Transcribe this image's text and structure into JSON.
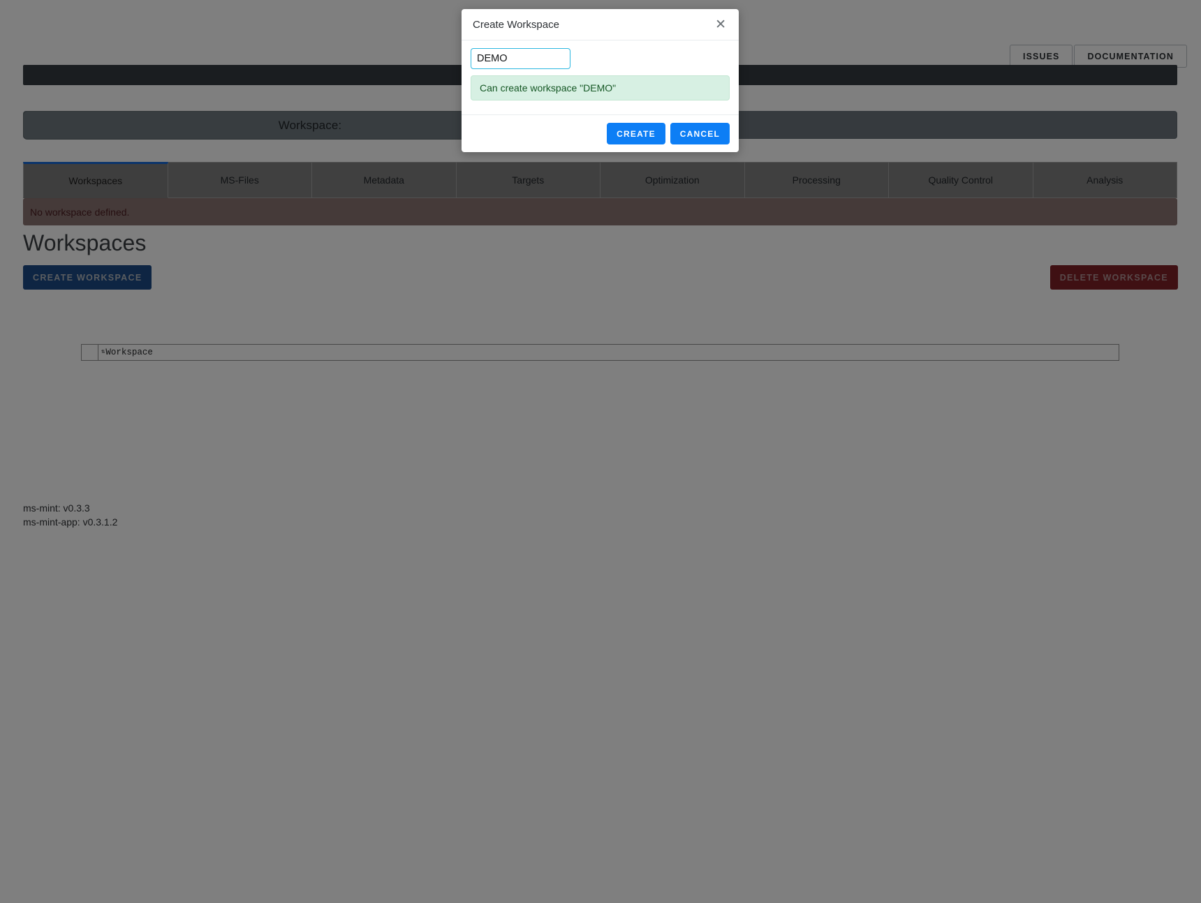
{
  "header": {
    "issues_label": "ISSUES",
    "documentation_label": "DOCUMENTATION"
  },
  "workspace_bar": {
    "label": "Workspace:"
  },
  "tabs": [
    {
      "label": "Workspaces",
      "active": true
    },
    {
      "label": "MS-Files",
      "active": false
    },
    {
      "label": "Metadata",
      "active": false
    },
    {
      "label": "Targets",
      "active": false
    },
    {
      "label": "Optimization",
      "active": false
    },
    {
      "label": "Processing",
      "active": false
    },
    {
      "label": "Quality Control",
      "active": false
    },
    {
      "label": "Analysis",
      "active": false
    }
  ],
  "alert": {
    "text": "No workspace defined."
  },
  "main": {
    "title": "Workspaces",
    "create_button": "CREATE WORKSPACE",
    "delete_button": "DELETE WORKSPACE"
  },
  "table": {
    "sort_icon": "⇅",
    "columns": [
      "Workspace"
    ],
    "rows": []
  },
  "versions": {
    "ms_mint": "ms-mint: v0.3.3",
    "ms_mint_app": "ms-mint-app: v0.3.1.2"
  },
  "modal": {
    "title": "Create Workspace",
    "close_icon": "✕",
    "input_value": "DEMO",
    "input_placeholder": "",
    "success_message": "Can create workspace \"DEMO\"",
    "create_label": "CREATE",
    "cancel_label": "CANCEL"
  },
  "colors": {
    "accent_blue": "#0d7ef5",
    "create_ws_blue": "#1c4a86",
    "delete_ws_red": "#7e2027",
    "navbar_dark": "#343a40",
    "success_bg": "#d7f0e3",
    "danger_bg": "#8b7472",
    "active_tab_border": "#1669d6"
  }
}
